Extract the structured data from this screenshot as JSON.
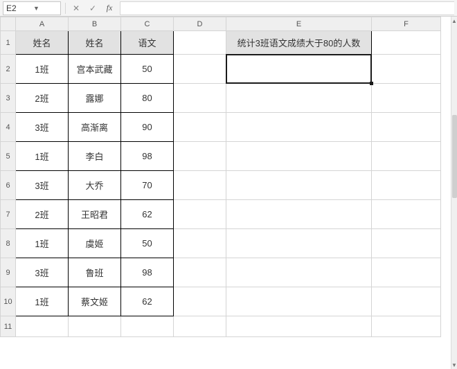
{
  "formula_bar": {
    "cell_ref": "E2",
    "cancel_icon": "✕",
    "enter_icon": "✓",
    "fx_label": "fx",
    "formula": ""
  },
  "columns": [
    "A",
    "B",
    "C",
    "D",
    "E",
    "F"
  ],
  "row_numbers": [
    "1",
    "2",
    "3",
    "4",
    "5",
    "6",
    "7",
    "8",
    "9",
    "10",
    "11"
  ],
  "table": {
    "headers": {
      "A": "姓名",
      "B": "姓名",
      "C": "语文"
    },
    "rows": [
      {
        "A": "1班",
        "B": "宫本武藏",
        "C": "50"
      },
      {
        "A": "2班",
        "B": "露娜",
        "C": "80"
      },
      {
        "A": "3班",
        "B": "高渐离",
        "C": "90"
      },
      {
        "A": "1班",
        "B": "李白",
        "C": "98"
      },
      {
        "A": "3班",
        "B": "大乔",
        "C": "70"
      },
      {
        "A": "2班",
        "B": "王昭君",
        "C": "62"
      },
      {
        "A": "1班",
        "B": "虞姬",
        "C": "50"
      },
      {
        "A": "3班",
        "B": "鲁班",
        "C": "98"
      },
      {
        "A": "1班",
        "B": "蔡文姬",
        "C": "62"
      }
    ]
  },
  "side": {
    "E1": "统计3班语文成绩大于80的人数",
    "E2": ""
  }
}
